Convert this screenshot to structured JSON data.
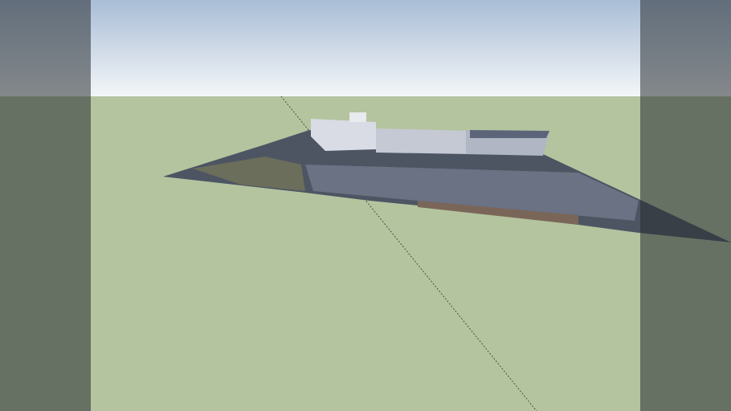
{
  "scene": {
    "sky_color": "#a9bdd6",
    "ground_color": "#b4c49f",
    "terrain_color": "#4a5260",
    "building_color": "#d8dbe3"
  }
}
